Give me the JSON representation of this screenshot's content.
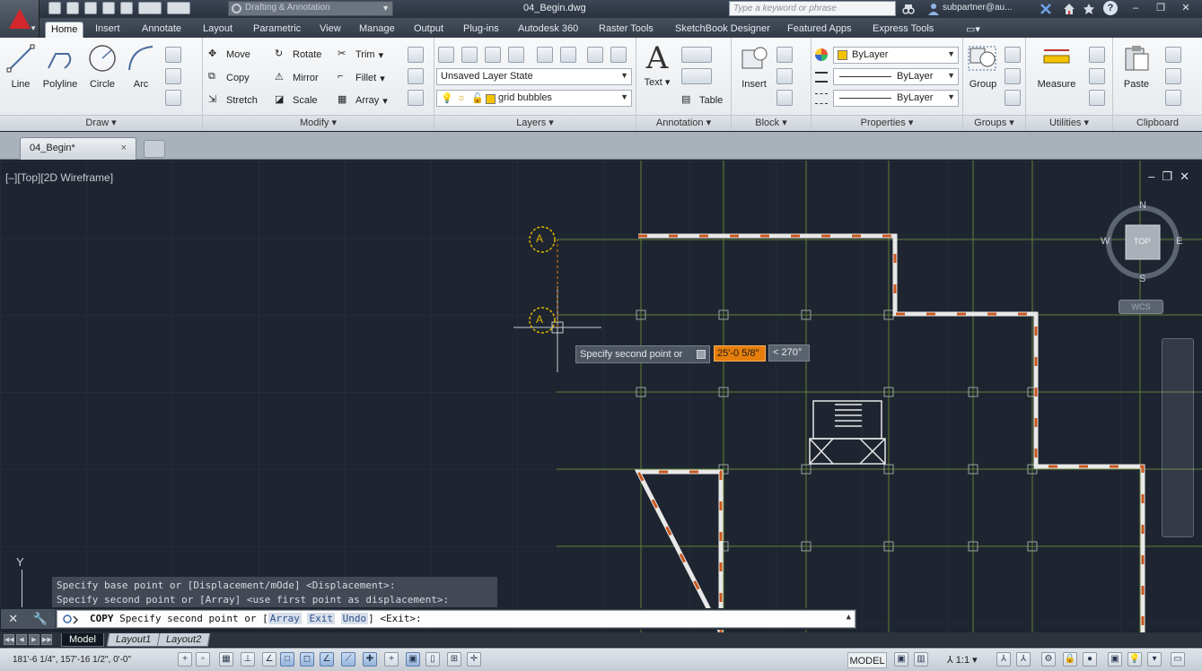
{
  "titlebar": {
    "workspace": "Drafting & Annotation",
    "doc_title": "04_Begin.dwg",
    "search_placeholder": "Type a keyword or phrase",
    "user": "subpartner@au...",
    "help": "?"
  },
  "ribbon_tabs": [
    {
      "label": "Home"
    },
    {
      "label": "Insert"
    },
    {
      "label": "Annotate"
    },
    {
      "label": "Layout"
    },
    {
      "label": "Parametric"
    },
    {
      "label": "View"
    },
    {
      "label": "Manage"
    },
    {
      "label": "Output"
    },
    {
      "label": "Plug-ins"
    },
    {
      "label": "Autodesk 360"
    },
    {
      "label": "Raster Tools"
    },
    {
      "label": "SketchBook Designer"
    },
    {
      "label": "Featured Apps"
    },
    {
      "label": "Express Tools"
    }
  ],
  "draw": {
    "title": "Draw",
    "line": "Line",
    "polyline": "Polyline",
    "circle": "Circle",
    "arc": "Arc"
  },
  "modify": {
    "title": "Modify",
    "move": "Move",
    "rotate": "Rotate",
    "trim": "Trim",
    "copy": "Copy",
    "mirror": "Mirror",
    "fillet": "Fillet",
    "stretch": "Stretch",
    "scale": "Scale",
    "array": "Array"
  },
  "layers": {
    "title": "Layers",
    "layer_state": "Unsaved Layer State",
    "current_layer": "grid bubbles"
  },
  "annotation": {
    "title": "Annotation",
    "text": "Text",
    "table": "Table"
  },
  "block": {
    "title": "Block",
    "insert": "Insert"
  },
  "properties": {
    "title": "Properties",
    "color": "ByLayer",
    "linetype": "ByLayer",
    "lineweight": "ByLayer"
  },
  "groups": {
    "title": "Groups",
    "group": "Group"
  },
  "utilities": {
    "title": "Utilities",
    "measure": "Measure"
  },
  "clipboard": {
    "title": "Clipboard",
    "paste": "Paste"
  },
  "doc_tab": {
    "label": "04_Begin*",
    "close": "×"
  },
  "viewport": {
    "label": "[–][Top][2D Wireframe]"
  },
  "prompt": {
    "text": "Specify second point or",
    "distance": "25'-0 5/8\"",
    "angle": "< 270°"
  },
  "viewcube": {
    "north": "N",
    "south": "S",
    "east": "E",
    "west": "W",
    "face": "TOP",
    "wcs": "WCS"
  },
  "grid_bubbles": [
    "A",
    "A"
  ],
  "ucs": "Y",
  "command_history": [
    "Specify base point or [Displacement/mOde] <Displacement>:",
    "Specify second point or [Array] <use first point as displacement>:"
  ],
  "command_line": {
    "command": "COPY",
    "prompt": "Specify second point or [",
    "options": [
      "Array",
      "Exit",
      "Undo"
    ],
    "suffix": "] <Exit>:"
  },
  "layout_tabs": [
    {
      "label": "Model"
    },
    {
      "label": "Layout1"
    },
    {
      "label": "Layout2"
    }
  ],
  "status": {
    "coords": "181'-6 1/4\", 157'-16 1/2\", 0'-0\"",
    "model": "MODEL",
    "scale": "1:1"
  },
  "colors": {
    "accent_orange": "#e67e0b",
    "grid_line": "#6b8a3a",
    "wall": "#e8e8e8",
    "brick": "#c9561c",
    "canvas_bg": "#1e2530"
  }
}
